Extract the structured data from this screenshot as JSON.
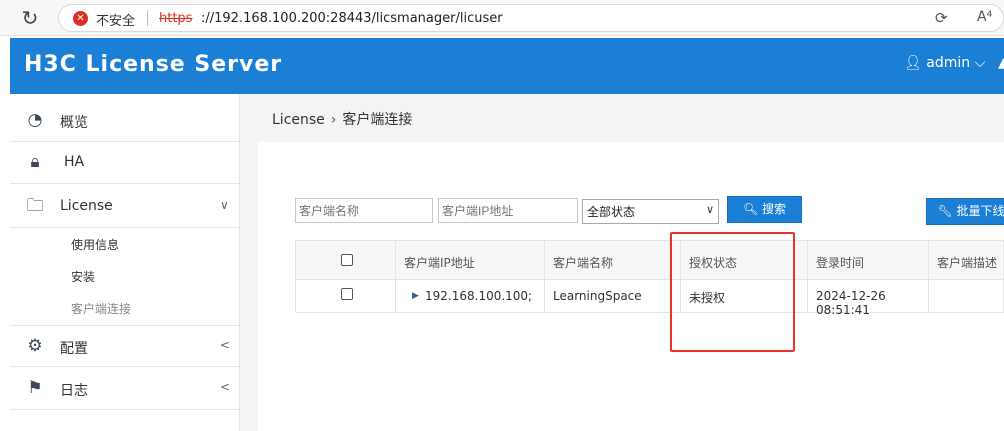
{
  "browser": {
    "insecure_label": "不安全",
    "url_scheme": "https",
    "url_rest": "://192.168.100.200:28443/licsmanager/licuser"
  },
  "header": {
    "logo": "H3C License Server",
    "user": "admin"
  },
  "sidebar": {
    "items": [
      {
        "label": "概览",
        "icon": "dashboard-icon"
      },
      {
        "label": "HA",
        "icon": "lock-icon"
      },
      {
        "label": "License",
        "icon": "folder-icon"
      },
      {
        "label": "配置",
        "icon": "gear-icon"
      },
      {
        "label": "日志",
        "icon": "flag-icon"
      }
    ],
    "subitems": [
      {
        "label": "使用信息"
      },
      {
        "label": "安装"
      },
      {
        "label": "客户端连接"
      }
    ]
  },
  "breadcrumb": {
    "root": "License",
    "current": "客户端连接"
  },
  "filters": {
    "name_placeholder": "客户端名称",
    "ip_placeholder": "客户端IP地址",
    "status_selected": "全部状态",
    "search_label": "搜索",
    "batch_label": "批量下线"
  },
  "table": {
    "columns": [
      "",
      "客户端IP地址",
      "客户端名称",
      "授权状态",
      "登录时间",
      "客户端描述"
    ],
    "rows": [
      {
        "ip": "192.168.100.100;",
        "name": "LearningSpace",
        "status": "未授权",
        "login_time": "2024-12-26 08:51:41",
        "desc": ""
      }
    ]
  },
  "colors": {
    "header_blue": "#1b7fd6",
    "highlight_red": "#e8332a"
  }
}
